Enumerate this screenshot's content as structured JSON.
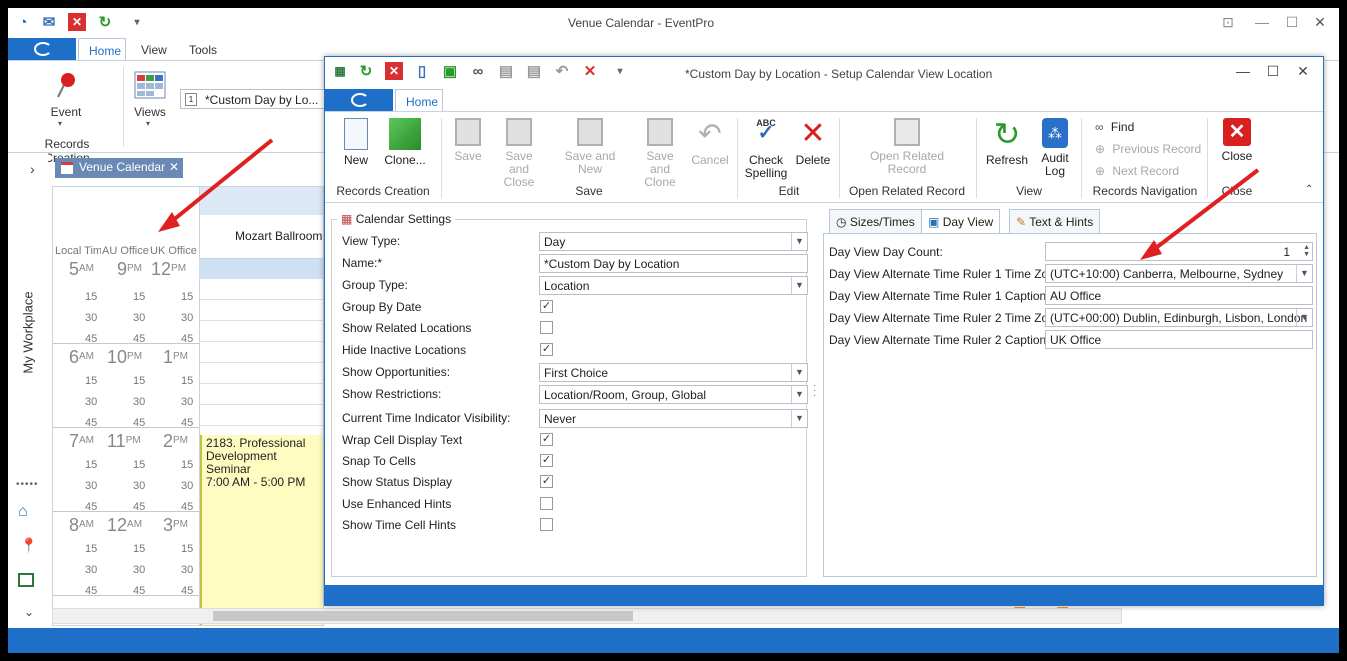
{
  "main": {
    "title": "Venue Calendar - EventPro",
    "tabs": [
      {
        "label": "Home"
      },
      {
        "label": "View"
      },
      {
        "label": "Tools"
      }
    ],
    "ribbon": {
      "event_label": "Event",
      "views_label": "Views",
      "group_records_creation": "Records Creation",
      "view_selector": "*Custom Day by Lo..."
    },
    "doc_tab": "Venue Calendar",
    "sidebar_label": "My Workplace",
    "calendar": {
      "headers": [
        "Local Time",
        "AU Office",
        "UK Office"
      ],
      "location": "Mozart Ballroom",
      "hours": [
        {
          "local": "5",
          "local_ap": "AM",
          "au": "9",
          "au_ap": "PM",
          "uk": "12",
          "uk_ap": "PM"
        },
        {
          "local": "6",
          "local_ap": "AM",
          "au": "10",
          "au_ap": "PM",
          "uk": "1",
          "uk_ap": "PM"
        },
        {
          "local": "7",
          "local_ap": "AM",
          "au": "11",
          "au_ap": "PM",
          "uk": "2",
          "uk_ap": "PM"
        },
        {
          "local": "8",
          "local_ap": "AM",
          "au": "12",
          "au_ap": "AM",
          "uk": "3",
          "uk_ap": "PM"
        }
      ],
      "minutes": [
        "15",
        "30",
        "45"
      ],
      "event_title": "2183. Professional Development Seminar",
      "event_time": "7:00 AM - 5:00 PM"
    }
  },
  "dialog": {
    "title": "*Custom Day by Location - Setup Calendar View Location",
    "tab_home": "Home",
    "ribbon": {
      "new": "New",
      "clone": "Clone...",
      "save": "Save",
      "save_close": "Save and Close",
      "save_new": "Save and New",
      "save_clone": "Save and Clone",
      "cancel": "Cancel",
      "check_spelling": "Check Spelling",
      "delete": "Delete",
      "open_related": "Open Related Record",
      "refresh": "Refresh",
      "audit_log": "Audit Log",
      "find": "Find",
      "previous_record": "Previous Record",
      "next_record": "Next Record",
      "close": "Close",
      "groups": {
        "records_creation": "Records Creation",
        "save": "Save",
        "edit": "Edit",
        "open_related": "Open Related Record",
        "view": "View",
        "records_navigation": "Records Navigation",
        "close": "Close"
      }
    },
    "settings_title": "Calendar Settings",
    "settings": [
      {
        "label": "View Type:",
        "type": "combo",
        "value": "Day"
      },
      {
        "label": "Name:*",
        "type": "text",
        "value": "*Custom Day by Location"
      },
      {
        "label": "Group Type:",
        "type": "combo",
        "value": "Location"
      },
      {
        "label": "Group By Date",
        "type": "check",
        "checked": true
      },
      {
        "label": "Show Related Locations",
        "type": "check",
        "checked": false
      },
      {
        "label": "Hide Inactive Locations",
        "type": "check",
        "checked": true
      },
      {
        "label": "Show Opportunities:",
        "type": "combo",
        "value": "First Choice"
      },
      {
        "label": "Show Restrictions:",
        "type": "combo",
        "value": "Location/Room, Group, Global"
      },
      {
        "label": "Current Time Indicator Visibility:",
        "type": "combo",
        "value": "Never"
      },
      {
        "label": "Wrap Cell Display Text",
        "type": "check",
        "checked": true
      },
      {
        "label": "Snap To Cells",
        "type": "check",
        "checked": true
      },
      {
        "label": "Show Status Display",
        "type": "check",
        "checked": true
      },
      {
        "label": "Use Enhanced Hints",
        "type": "check",
        "checked": false
      },
      {
        "label": "Show Time Cell Hints",
        "type": "check",
        "checked": false
      }
    ],
    "right_tabs": [
      {
        "label": "Sizes/Times"
      },
      {
        "label": "Day View"
      },
      {
        "label": "Text & Hints"
      }
    ],
    "dayview": {
      "count_label": "Day View Day Count:",
      "count_value": "1",
      "tz1_label": "Day View Alternate Time Ruler 1 Time Zone:",
      "tz1_value": "(UTC+10:00) Canberra, Melbourne, Sydney",
      "cap1_label": "Day View Alternate Time Ruler 1 Caption:",
      "cap1_value": "AU Office",
      "tz2_label": "Day View Alternate Time Ruler 2 Time Zone:",
      "tz2_value": "(UTC+00:00) Dublin, Edinburgh, Lisbon, London",
      "cap2_label": "Day View Alternate Time Ruler 2 Caption:",
      "cap2_value": "UK Office"
    }
  },
  "colors": {
    "accent": "#1e6fc8",
    "annotation_arrow": "#e02020",
    "event_fill": "#fefcc0"
  }
}
